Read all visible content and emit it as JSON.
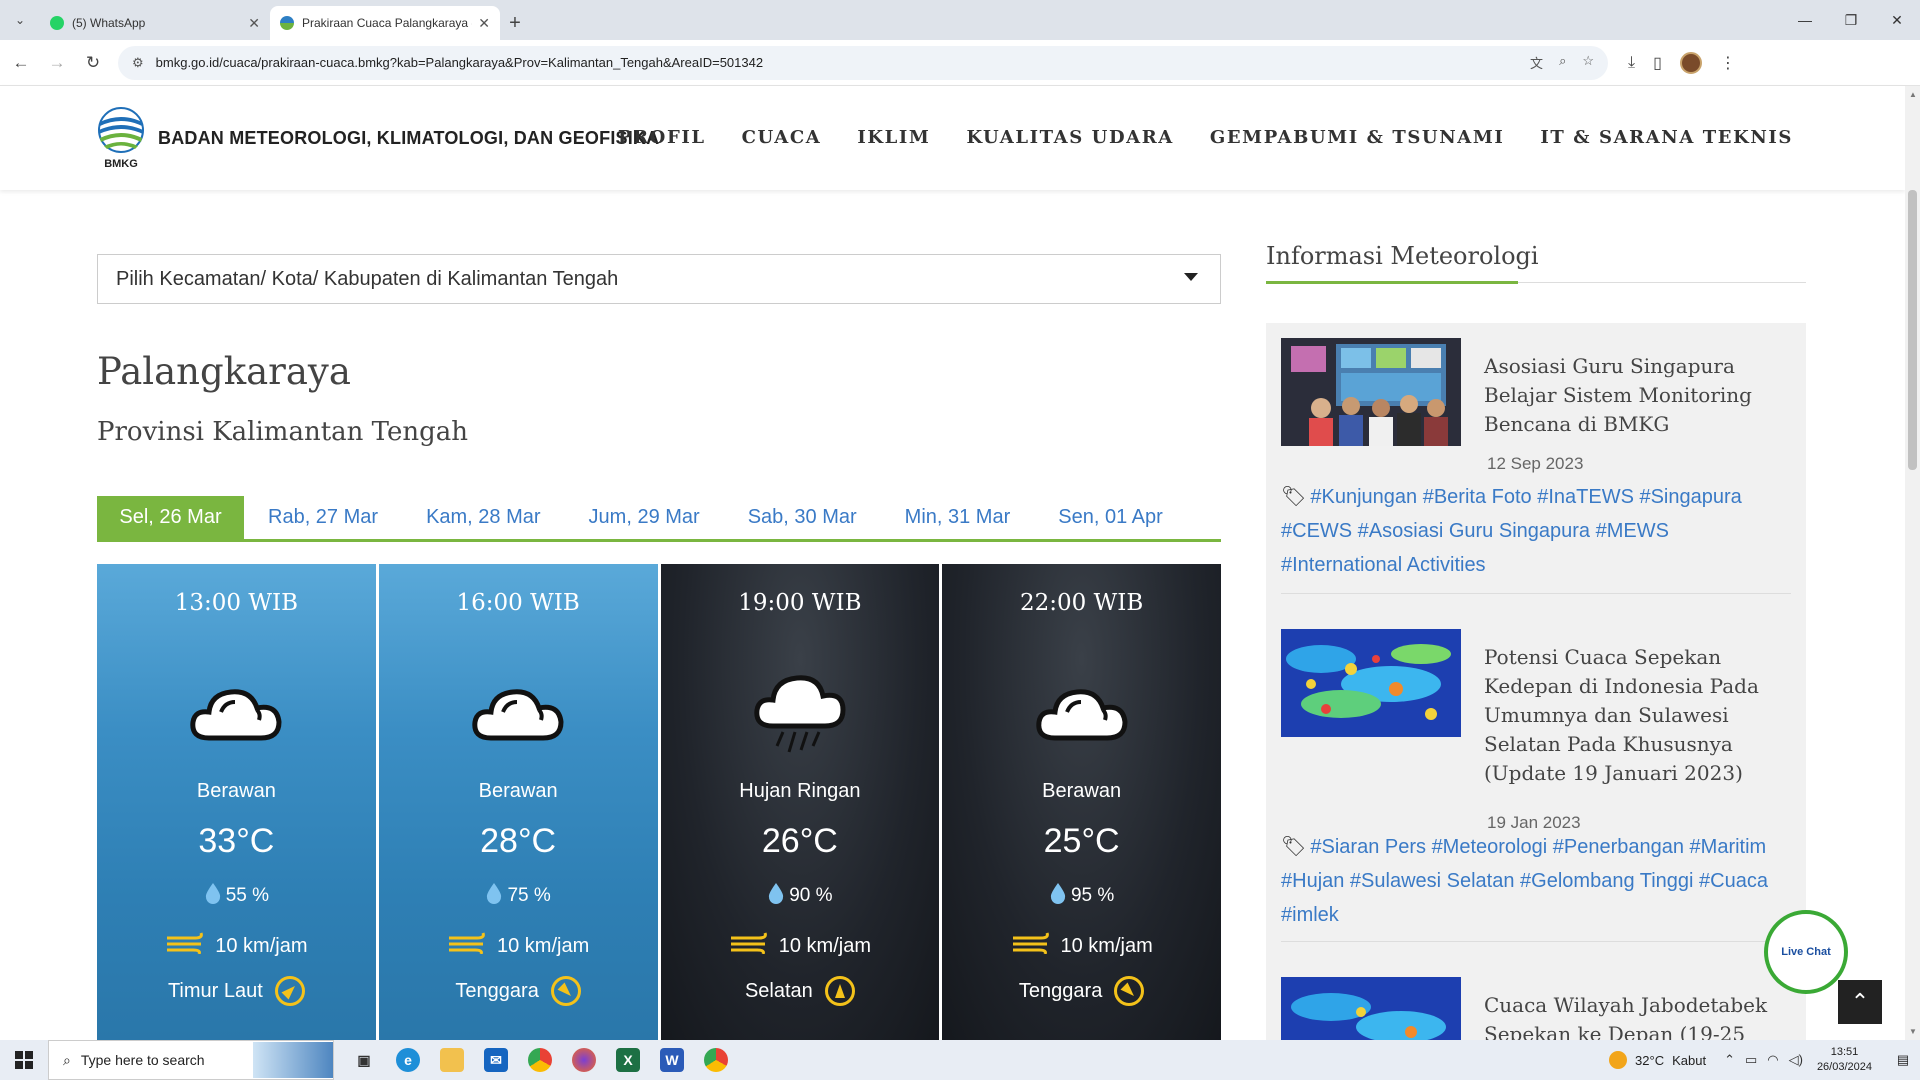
{
  "browser": {
    "tabs": [
      {
        "label": "(5) WhatsApp",
        "active": false
      },
      {
        "label": "Prakiraan Cuaca Palangkaraya -",
        "active": true
      }
    ],
    "url": "bmkg.go.id/cuaca/prakiraan-cuaca.bmkg?kab=Palangkaraya&Prov=Kalimantan_Tengah&AreaID=501342"
  },
  "header": {
    "logo_text": "BMKG",
    "org_name": "BADAN METEOROLOGI, KLIMATOLOGI, DAN GEOFISIKA",
    "nav": [
      "PROFIL",
      "CUACA",
      "IKLIM",
      "KUALITAS UDARA",
      "GEMPABUMI & TSUNAMI",
      "IT & SARANA TEKNIS"
    ]
  },
  "main": {
    "location_select": "Pilih Kecamatan/ Kota/ Kabupaten di Kalimantan Tengah",
    "city": "Palangkaraya",
    "province": "Provinsi Kalimantan Tengah",
    "day_tabs": [
      "Sel, 26 Mar",
      "Rab, 27 Mar",
      "Kam, 28 Mar",
      "Jum, 29 Mar",
      "Sab, 30 Mar",
      "Min, 31 Mar",
      "Sen, 01 Apr"
    ],
    "forecasts": [
      {
        "time": "13:00 WIB",
        "icon": "cloud-icon",
        "desc": "Berawan",
        "temp": "33°C",
        "humidity": "55 %",
        "wind_speed": "10 km/jam",
        "wind_dir": "Timur Laut",
        "compass_deg": 45,
        "theme": "day"
      },
      {
        "time": "16:00 WIB",
        "icon": "cloud-icon",
        "desc": "Berawan",
        "temp": "28°C",
        "humidity": "75 %",
        "wind_speed": "10 km/jam",
        "wind_dir": "Tenggara",
        "compass_deg": 135,
        "theme": "day"
      },
      {
        "time": "19:00 WIB",
        "icon": "rain-cloud-icon",
        "desc": "Hujan Ringan",
        "temp": "26°C",
        "humidity": "90 %",
        "wind_speed": "10 km/jam",
        "wind_dir": "Selatan",
        "compass_deg": 0,
        "theme": "night"
      },
      {
        "time": "22:00 WIB",
        "icon": "cloud-icon",
        "desc": "Berawan",
        "temp": "25°C",
        "humidity": "95 %",
        "wind_speed": "10 km/jam",
        "wind_dir": "Tenggara",
        "compass_deg": 135,
        "theme": "night"
      }
    ]
  },
  "sidebar": {
    "title": "Informasi Meteorologi",
    "news": [
      {
        "title": "Asosiasi Guru Singapura Belajar Sistem Monitoring Bencana di BMKG",
        "date": "12 Sep 2023",
        "tags": "#Kunjungan #Berita Foto #InaTEWS #Singapura #CEWS #Asosiasi Guru Singapura #MEWS #International Activities"
      },
      {
        "title": "Potensi Cuaca Sepekan Kedepan di Indonesia Pada Umumnya dan Sulawesi Selatan Pada Khususnya (Update 19 Januari 2023)",
        "date": "19 Jan 2023",
        "tags": "#Siaran Pers #Meteorologi #Penerbangan #Maritim #Hujan #Sulawesi Selatan #Gelombang Tinggi #Cuaca #imlek"
      },
      {
        "title": "Cuaca Wilayah Jabodetabek Sepekan ke Depan (19-25",
        "date": "",
        "tags": ""
      }
    ],
    "livechat": "Live Chat"
  },
  "taskbar": {
    "search_placeholder": "Type here to search",
    "weather_temp": "32°C",
    "weather_desc": "Kabut",
    "time": "13:51",
    "date": "26/03/2024"
  }
}
